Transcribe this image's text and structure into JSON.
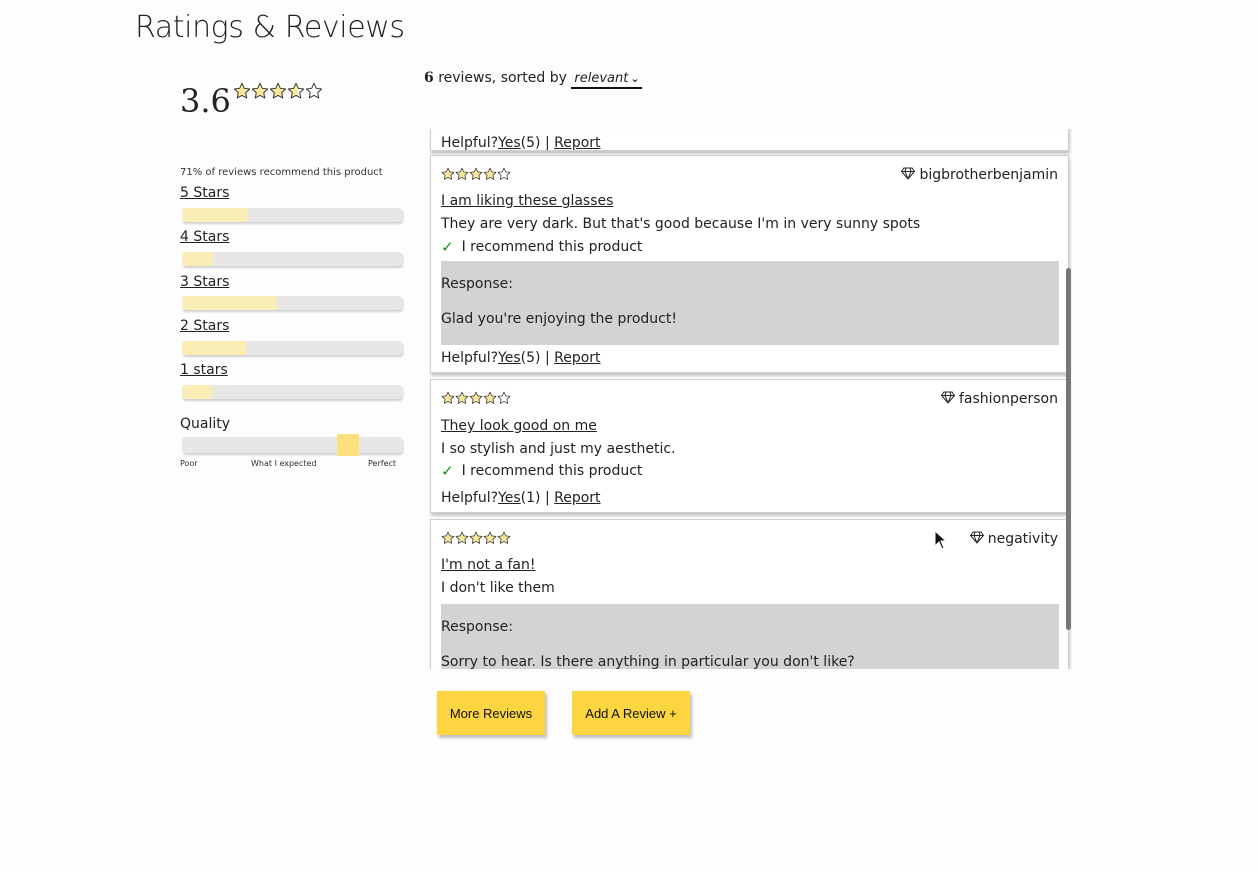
{
  "header": {
    "title": "Ratings & Reviews"
  },
  "summary": {
    "average": "3.6",
    "average_stars": 3.6,
    "recommend_text": "71% of reviews recommend this product",
    "breakdown": [
      {
        "label": "5 Stars",
        "fraction": 0.3
      },
      {
        "label": "4 Stars",
        "fraction": 0.14
      },
      {
        "label": "3 Stars",
        "fraction": 0.43
      },
      {
        "label": "2 Stars",
        "fraction": 0.29
      },
      {
        "label": "1 stars",
        "fraction": 0.14
      }
    ],
    "characteristic": {
      "name": "Quality",
      "value_fraction": 0.755,
      "scale_labels": [
        "Poor",
        "What I expected",
        "Perfect"
      ]
    }
  },
  "sort": {
    "count": "6",
    "text": " reviews, sorted by ",
    "selected": "relevant"
  },
  "reviews": [
    {
      "helpful_label": "Helpful?",
      "yes_label": "Yes",
      "yes_count": "(5)",
      "separator": " | ",
      "report_label": "Report"
    },
    {
      "rating": 4,
      "username": "bigbrotherbenjamin",
      "title": "I am liking these glasses",
      "body": "They are very dark. But that's good because I'm in very sunny spots",
      "recommend": "I recommend this product",
      "response_label": "Response:",
      "response_text": "Glad you're enjoying the product!",
      "helpful_label": "Helpful?",
      "yes_label": "Yes",
      "yes_count": "(5)",
      "separator": " | ",
      "report_label": "Report"
    },
    {
      "rating": 4,
      "username": "fashionperson",
      "title": "They look good on me",
      "body": "I so stylish and just my aesthetic.",
      "recommend": "I recommend this product",
      "helpful_label": "Helpful?",
      "yes_label": "Yes",
      "yes_count": "(1)",
      "separator": " | ",
      "report_label": "Report"
    },
    {
      "rating": 5,
      "username": "negativity",
      "title": "I'm not a fan!",
      "body": "I don't like them",
      "response_label": "Response:",
      "response_text": "Sorry to hear. Is there anything in particular you don't like?"
    }
  ],
  "buttons": {
    "more_reviews": "More Reviews",
    "add_review": "Add A Review +"
  },
  "colors": {
    "accent": "#fcd540",
    "bar_fill": "#fbedb6",
    "bar_track": "#e9e6e6",
    "response_bg": "#d3d3d3",
    "check": "#1b8a1b"
  }
}
